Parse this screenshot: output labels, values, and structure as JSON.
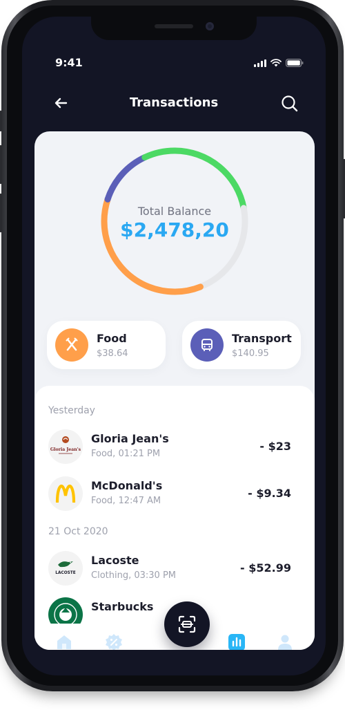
{
  "status": {
    "time": "9:41"
  },
  "header": {
    "title": "Transactions"
  },
  "balance": {
    "label": "Total Balance",
    "value": "$2,478,20",
    "ring": [
      {
        "name": "green",
        "color": "#4cd964",
        "fraction": 0.22
      },
      {
        "name": "gray",
        "color": "#e6e7ea",
        "fraction": 0.22
      },
      {
        "name": "orange",
        "color": "#ff9f4a",
        "fraction": 0.36
      },
      {
        "name": "purple",
        "color": "#5b5fb8",
        "fraction": 0.13
      },
      {
        "name": "green-tail",
        "color": "#4cd964",
        "fraction": 0.07
      }
    ]
  },
  "categories": [
    {
      "name": "Food",
      "amount": "$38.64",
      "icon": "fork-knife-icon",
      "color": "#ff9f4a"
    },
    {
      "name": "Transport",
      "amount": "$140.95",
      "icon": "bus-icon",
      "color": "#5b5fb8"
    }
  ],
  "sections": [
    {
      "label": "Yesterday",
      "items": [
        {
          "name": "Gloria Jean's",
          "meta": "Food, 01:21 PM",
          "amount": "- $23",
          "logo": "gloria-jeans-logo"
        },
        {
          "name": "McDonald's",
          "meta": "Food, 12:47 AM",
          "amount": "- $9.34",
          "logo": "mcdonalds-logo"
        }
      ]
    },
    {
      "label": "21 Oct 2020",
      "items": [
        {
          "name": "Lacoste",
          "meta": "Clothing, 03:30 PM",
          "amount": "- $52.99",
          "logo": "lacoste-logo"
        },
        {
          "name": "Starbucks",
          "meta": "",
          "amount": "",
          "logo": "starbucks-logo"
        }
      ]
    }
  ],
  "logos": {
    "gloria": "Gloria Jean's",
    "lacoste": "LACOSTE"
  },
  "tabbar": {
    "items": [
      "home-icon",
      "discount-icon",
      "scan-icon",
      "stats-icon",
      "profile-icon"
    ],
    "active": "stats-icon",
    "accent": "#29b6f6",
    "inactive": "#cfe7fb"
  }
}
